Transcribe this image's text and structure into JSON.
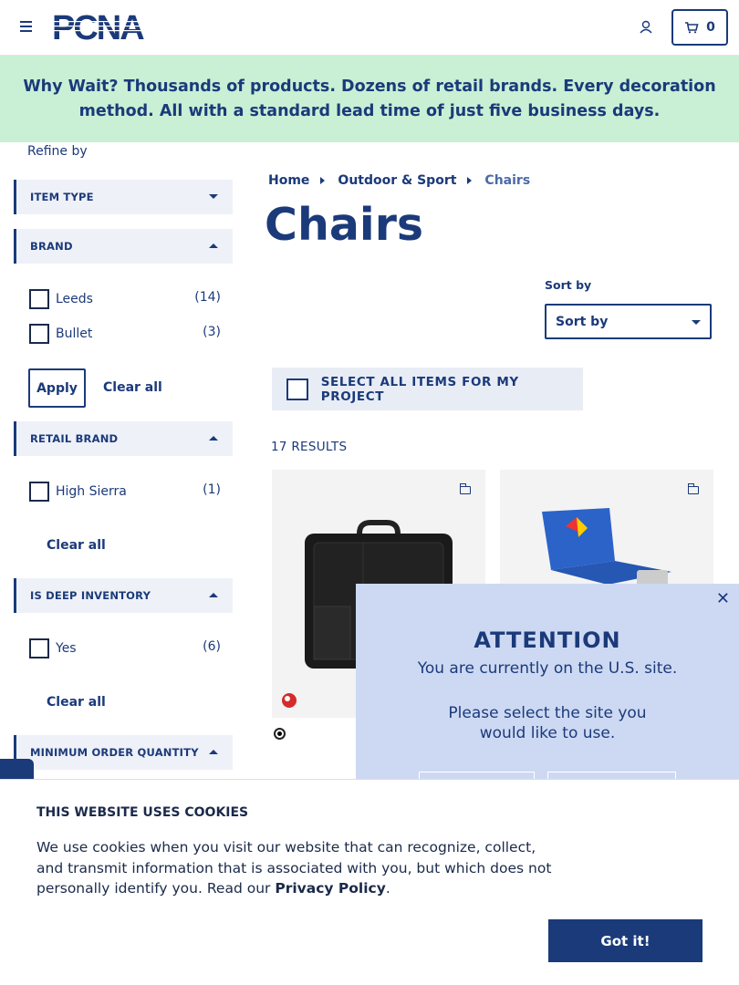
{
  "header": {
    "brand": "PCNA",
    "cart_count": "0"
  },
  "banner": {
    "text": "Why Wait? Thousands of products. Dozens of retail brands. Every decoration method. All with a standard lead time of just five business days."
  },
  "sidebar": {
    "refine_label": "Refine by",
    "facets": [
      {
        "label": "ITEM TYPE"
      },
      {
        "label": "BRAND",
        "options": [
          {
            "label": "Leeds",
            "count": "(14)"
          },
          {
            "label": "Bullet",
            "count": "(3)"
          }
        ]
      },
      {
        "label": "RETAIL BRAND",
        "options": [
          {
            "label": "High Sierra",
            "count": "(1)"
          }
        ]
      },
      {
        "label": "IS DEEP INVENTORY",
        "options": [
          {
            "label": "Yes",
            "count": "(6)"
          }
        ]
      },
      {
        "label": "MINIMUM ORDER QUANTITY"
      }
    ],
    "apply_label": "Apply",
    "clear_all_label": "Clear all"
  },
  "breadcrumb": [
    "Home",
    "Outdoor & Sport",
    "Chairs"
  ],
  "page_title": "Chairs",
  "sort": {
    "label": "Sort by",
    "selected": "Sort by"
  },
  "select_all_label": "SELECT ALL ITEMS FOR MY PROJECT",
  "results_label": "17 RESULTS",
  "products": [
    {
      "name": "black-seat-cushion-bag",
      "color": "#1a1a1a"
    },
    {
      "name": "blue-folding-chair",
      "color": "#2b63c9"
    }
  ],
  "attention": {
    "title": "ATTENTION",
    "line1": "You are currently on the U.S. site.",
    "line2": "Please select the site you",
    "line3": "would like to use."
  },
  "cookie": {
    "title": "THIS WEBSITE USES COOKIES",
    "text_before": "We use cookies when you visit our website that can recognize, collect, and transmit information that is associated with you, but which does not personally identify you. Read our ",
    "link": "Privacy Policy",
    "text_after": ".",
    "button": "Got it!"
  },
  "colors": {
    "primary": "#1b3a7a",
    "banner_bg": "#c9f0d5",
    "modal_bg": "#cdd9f3"
  }
}
